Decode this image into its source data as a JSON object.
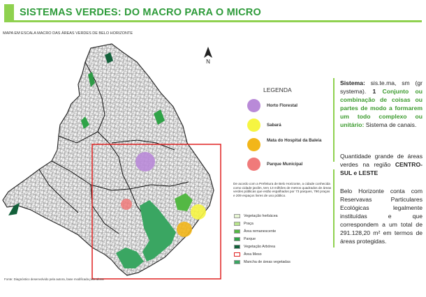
{
  "header": {
    "title": "SISTEMAS VERDES: DO MACRO PARA O MICRO"
  },
  "map": {
    "caption": "MAPA EM ESCALA MACRO DAS ÁREAS VERDES DE BELO HORIZONTE",
    "north_label": "N",
    "source": "Fonte: Diagnóstico desenvolvido pela autora, base modificada pela aluna"
  },
  "legend": {
    "title": "LEGENDA",
    "items": [
      {
        "label": "Horto Florestal",
        "color": "#b98ad8"
      },
      {
        "label": "Sabará",
        "color": "#f6f542"
      },
      {
        "label": "Mata do Hospital da Baleia",
        "color": "#f2b619"
      },
      {
        "label": "Parque Municipal",
        "color": "#f07a7a"
      }
    ],
    "swatches": [
      {
        "label": "Vegetação herbácea",
        "color": "#e6f5d3"
      },
      {
        "label": "Praça",
        "color": "#b7e38c"
      },
      {
        "label": "Área remanescente",
        "color": "#54b844"
      },
      {
        "label": "Parque",
        "color": "#2fa347"
      },
      {
        "label": "Vegetação Arbórea",
        "color": "#12603a"
      },
      {
        "label": "Área Meso",
        "color": "#ffffff",
        "border": "#e02020"
      },
      {
        "label": "Mancha de áreas vegetadas",
        "color": "#3aa662"
      }
    ]
  },
  "note": "De acordo com a Prefeitura de Belo Horizonte, a cidade conhecida como cidade jardim, tem 13 milhões de metros quadrados de áreas verdes públicas que estão espalhados por 73 parques, 790 praças e 209 espaços livres de uso público.",
  "definition": {
    "term": "Sistema:",
    "pron": " sis.te.ma, sm (gr systema). ",
    "num": "1",
    "green_text": " Conjunto ou combinação de coisas ou partes de modo a formarem um todo complexo ou unitário:",
    "tail": " Sistema de canais."
  },
  "paragraph2": {
    "text": "Quantidade grande de áreas verdes na região ",
    "bold": "CENTRO-SUL e LESTE"
  },
  "paragraph3": {
    "text": "Belo Horizonte conta com Reservavas Particulares Ecológicas legalmente instituídas e que correspondem a um total de 291.128,20 m² em termos de áreas protegidas."
  }
}
